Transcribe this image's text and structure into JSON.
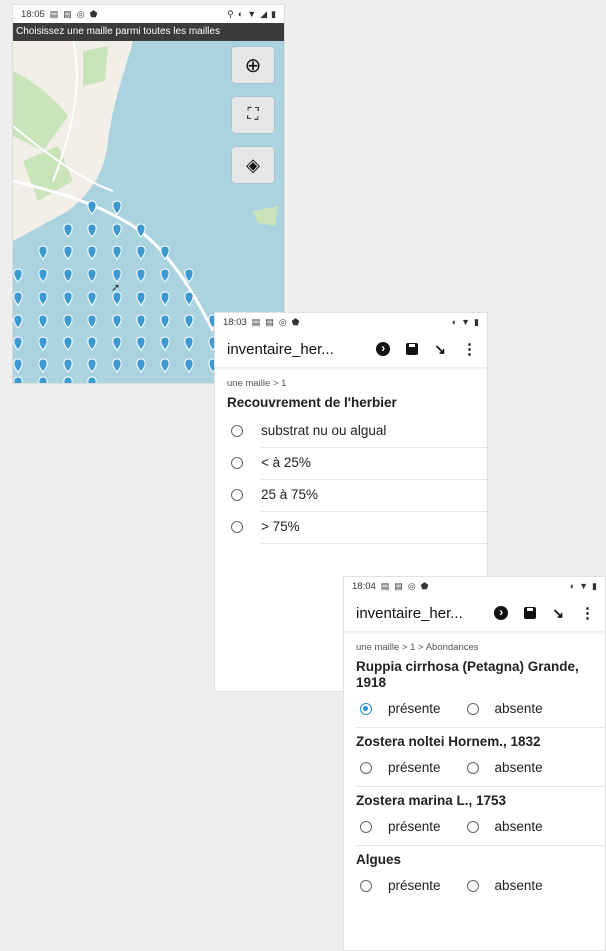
{
  "map_screen": {
    "status": {
      "time": "18:05",
      "left_icons": [
        "clipboard-icon",
        "clipboard-icon",
        "target-icon",
        "shield-icon"
      ],
      "right_icons": [
        "location-icon",
        "sync-icon",
        "wifi-icon",
        "battery-icon"
      ]
    },
    "title": "Choisissez une maille parmi toutes les mailles",
    "buttons": {
      "locate": "locate-icon",
      "fullscreen": "fullscreen-icon",
      "layers": "layers-icon"
    },
    "colors": {
      "water": "#aad3df",
      "land": "#f2efe9",
      "green": "#c8e4b8",
      "marker": "#3d9ad1"
    }
  },
  "form1": {
    "status": {
      "time": "18:03"
    },
    "app_title": "inventaire_her...",
    "breadcrumb": "une maille > 1",
    "question": "Recouvrement de l'herbier",
    "options": [
      "substrat nu ou algual",
      "< à 25%",
      "25 à 75%",
      "> 75%"
    ]
  },
  "form2": {
    "status": {
      "time": "18:04"
    },
    "app_title": "inventaire_her...",
    "breadcrumb": "une maille > 1 > Abondances",
    "choices": {
      "present": "présente",
      "absent": "absente"
    },
    "species": [
      {
        "name": "Ruppia cirrhosa (Petagna) Grande, 1918",
        "selected": "present"
      },
      {
        "name": "Zostera noltei Hornem., 1832",
        "selected": ""
      },
      {
        "name": "Zostera marina L., 1753",
        "selected": ""
      },
      {
        "name": "Algues",
        "selected": ""
      }
    ]
  }
}
